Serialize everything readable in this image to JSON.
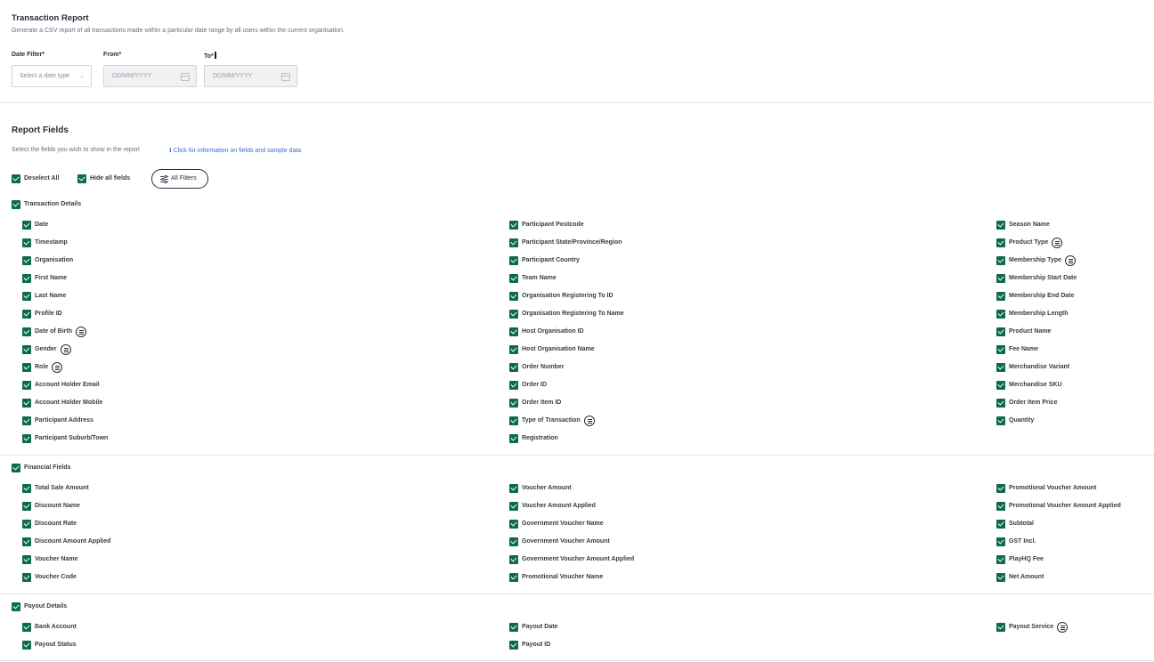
{
  "report": {
    "title": "Transaction Report",
    "description": "Generate a CSV report of all transactions made within a particular date range by all users within the current organisation."
  },
  "filters": {
    "date_filter_label": "Date Filter*",
    "date_filter_placeholder": "Select a date type",
    "from_label": "From*",
    "from_placeholder": "DD/MM/YYYY",
    "to_label": "To*",
    "to_placeholder": "DD/MM/YYYY"
  },
  "report_fields": {
    "title": "Report Fields",
    "subtitle": "Select the fields you wish to show in the report",
    "info_link": "Click for information on fields and sample data",
    "deselect_all": "Deselect All",
    "hide_all_fields": "Hide all fields",
    "all_filters": "All Filters"
  },
  "sections": [
    {
      "name": "Transaction Details",
      "columns": [
        [
          {
            "label": "Date",
            "checked": true
          },
          {
            "label": "Timestamp",
            "checked": true
          },
          {
            "label": "Organisation",
            "checked": true
          },
          {
            "label": "First Name",
            "checked": true
          },
          {
            "label": "Last Name",
            "checked": true
          },
          {
            "label": "Profile ID",
            "checked": true
          },
          {
            "label": "Date of Birth",
            "checked": true,
            "info": true
          },
          {
            "label": "Gender",
            "checked": true,
            "info": true
          },
          {
            "label": "Role",
            "checked": true,
            "info": true
          },
          {
            "label": "Account Holder Email",
            "checked": true
          },
          {
            "label": "Account Holder Mobile",
            "checked": true
          },
          {
            "label": "Participant Address",
            "checked": true
          },
          {
            "label": "Participant Suburb/Town",
            "checked": true
          }
        ],
        [
          {
            "label": "Participant Postcode",
            "checked": true
          },
          {
            "label": "Participant State/Province/Region",
            "checked": true
          },
          {
            "label": "Participant Country",
            "checked": true
          },
          {
            "label": "Team Name",
            "checked": true
          },
          {
            "label": "Organisation Registering To ID",
            "checked": true
          },
          {
            "label": "Organisation Registering To Name",
            "checked": true
          },
          {
            "label": "Host Organisation ID",
            "checked": true
          },
          {
            "label": "Host Organisation Name",
            "checked": true
          },
          {
            "label": "Order Number",
            "checked": true
          },
          {
            "label": "Order ID",
            "checked": true
          },
          {
            "label": "Order Item ID",
            "checked": true
          },
          {
            "label": "Type of Transaction",
            "checked": true,
            "info": true
          },
          {
            "label": "Registration",
            "checked": true
          }
        ],
        [
          {
            "label": "Season Name",
            "checked": true
          },
          {
            "label": "Product Type",
            "checked": true,
            "info": true
          },
          {
            "label": "Membership Type",
            "checked": true,
            "info": true
          },
          {
            "label": "Membership Start Date",
            "checked": true
          },
          {
            "label": "Membership End Date",
            "checked": true
          },
          {
            "label": "Membership Length",
            "checked": true
          },
          {
            "label": "Product Name",
            "checked": true
          },
          {
            "label": "Fee Name",
            "checked": true
          },
          {
            "label": "Merchandise Variant",
            "checked": true
          },
          {
            "label": "Merchandise SKU",
            "checked": true
          },
          {
            "label": "Order Item Price",
            "checked": true
          },
          {
            "label": "Quantity",
            "checked": true
          }
        ]
      ]
    },
    {
      "name": "Financial Fields",
      "columns": [
        [
          {
            "label": "Total Sale Amount",
            "checked": true
          },
          {
            "label": "Discount Name",
            "checked": true
          },
          {
            "label": "Discount Rate",
            "checked": true
          },
          {
            "label": "Discount Amount Applied",
            "checked": true
          },
          {
            "label": "Voucher Name",
            "checked": true
          },
          {
            "label": "Voucher Code",
            "checked": true
          }
        ],
        [
          {
            "label": "Voucher Amount",
            "checked": true
          },
          {
            "label": "Voucher Amount Applied",
            "checked": true
          },
          {
            "label": "Government Voucher Name",
            "checked": true
          },
          {
            "label": "Government Voucher Amount",
            "checked": true
          },
          {
            "label": "Government Voucher Amount Applied",
            "checked": true
          },
          {
            "label": "Promotional Voucher Name",
            "checked": true
          }
        ],
        [
          {
            "label": "Promotional Voucher Amount",
            "checked": true
          },
          {
            "label": "Promotional Voucher Amount Applied",
            "checked": true
          },
          {
            "label": "Subtotal",
            "checked": true
          },
          {
            "label": "GST Incl.",
            "checked": true
          },
          {
            "label": "PlayHQ Fee",
            "checked": true
          },
          {
            "label": "Net Amount",
            "checked": true
          }
        ]
      ]
    },
    {
      "name": "Payout Details",
      "columns": [
        [
          {
            "label": "Bank Account",
            "checked": true
          },
          {
            "label": "Payout Status",
            "checked": true
          }
        ],
        [
          {
            "label": "Payout Date",
            "checked": true
          },
          {
            "label": "Payout ID",
            "checked": true
          }
        ],
        [
          {
            "label": "Payout Service",
            "checked": true,
            "info": true
          }
        ]
      ]
    }
  ],
  "colors": {
    "checkbox": "#0d6b4a",
    "link": "#3a6ad9",
    "text": "#2b2b3a"
  }
}
